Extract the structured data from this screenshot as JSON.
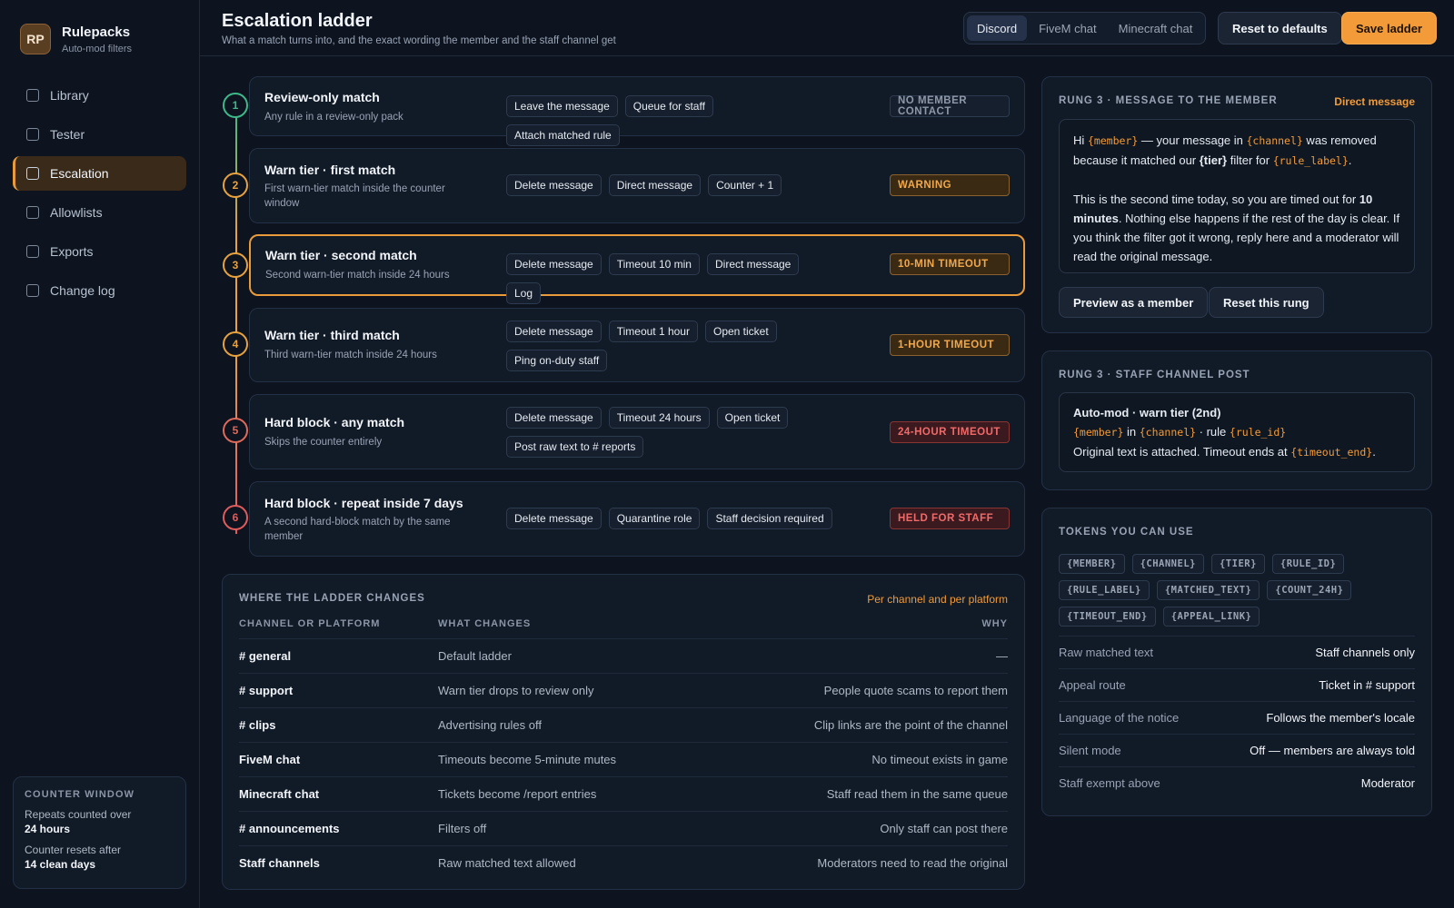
{
  "brand": {
    "initials": "RP",
    "name": "Rulepacks",
    "subtitle": "Auto-mod filters"
  },
  "nav": [
    {
      "label": "Library"
    },
    {
      "label": "Tester"
    },
    {
      "label": "Escalation",
      "active": true
    },
    {
      "label": "Allowlists"
    },
    {
      "label": "Exports"
    },
    {
      "label": "Change log"
    }
  ],
  "counter_window": {
    "title": "COUNTER WINDOW",
    "repeats_label": "Repeats counted over",
    "repeats_value": "24 hours",
    "resets_label": "Counter resets after",
    "resets_value": "14 clean days"
  },
  "header": {
    "title": "Escalation ladder",
    "subtitle": "What a match turns into, and the exact wording the member and the staff channel get",
    "platforms": [
      "Discord",
      "FiveM chat",
      "Minecraft chat"
    ],
    "active_platform": "Discord",
    "reset_label": "Reset to defaults",
    "save_label": "Save ladder"
  },
  "rungs": [
    {
      "num": "1",
      "title": "Review-only match",
      "subtitle": "Any rule in a review-only pack",
      "actions": [
        "Leave the message",
        "Queue for staff",
        "Attach matched rule"
      ],
      "badge": "NO MEMBER CONTACT"
    },
    {
      "num": "2",
      "title": "Warn tier · first match",
      "subtitle": "First warn-tier match inside the counter window",
      "actions": [
        "Delete message",
        "Direct message",
        "Counter + 1"
      ],
      "badge": "WARNING"
    },
    {
      "num": "3",
      "title": "Warn tier · second match",
      "subtitle": "Second warn-tier match inside 24 hours",
      "actions": [
        "Delete message",
        "Timeout 10 min",
        "Direct message",
        "Log"
      ],
      "badge": "10-MIN TIMEOUT"
    },
    {
      "num": "4",
      "title": "Warn tier · third match",
      "subtitle": "Third warn-tier match inside 24 hours",
      "actions": [
        "Delete message",
        "Timeout 1 hour",
        "Open ticket",
        "Ping on-duty staff"
      ],
      "badge": "1-HOUR TIMEOUT"
    },
    {
      "num": "5",
      "title": "Hard block · any match",
      "subtitle": "Skips the counter entirely",
      "actions": [
        "Delete message",
        "Timeout 24 hours",
        "Open ticket",
        "Post raw text to # reports"
      ],
      "badge": "24-HOUR TIMEOUT"
    },
    {
      "num": "6",
      "title": "Hard block · repeat inside 7 days",
      "subtitle": "A second hard-block match by the same member",
      "actions": [
        "Delete message",
        "Quarantine role",
        "Staff decision required"
      ],
      "badge": "HELD FOR STAFF"
    }
  ],
  "ladder_changes": {
    "title": "WHERE THE LADDER CHANGES",
    "note": "Per channel and per platform",
    "headers": [
      "CHANNEL OR PLATFORM",
      "WHAT CHANGES",
      "WHY"
    ],
    "rows": [
      [
        "# general",
        "Default ladder",
        "—"
      ],
      [
        "# support",
        "Warn tier drops to review only",
        "People quote scams to report them"
      ],
      [
        "# clips",
        "Advertising rules off",
        "Clip links are the point of the channel"
      ],
      [
        "FiveM chat",
        "Timeouts become 5-minute mutes",
        "No timeout exists in game"
      ],
      [
        "Minecraft chat",
        "Tickets become /report entries",
        "Staff read them in the same queue"
      ],
      [
        "# announcements",
        "Filters off",
        "Only staff can post there"
      ],
      [
        "Staff channels",
        "Raw matched text allowed",
        "Moderators need to read the original"
      ]
    ]
  },
  "member_message": {
    "title": "RUNG 3 · MESSAGE TO THE MEMBER",
    "channel_link": "Direct message",
    "p1": [
      "Hi ",
      "{member}",
      " — your message in ",
      "{channel}",
      " was removed because it matched our ",
      "{tier}",
      " filter for ",
      "{rule_label}",
      "."
    ],
    "p2": [
      "This is the second time today, so you are timed out for ",
      "10 minutes",
      ". Nothing else happens if the rest of the day is clear. If you think the filter got it wrong, reply here and a moderator will read the original message."
    ],
    "preview_label": "Preview as a member",
    "reset_label": "Reset this rung"
  },
  "staff_post": {
    "title": "RUNG 3 · STAFF CHANNEL POST",
    "line1": "Auto-mod · warn tier (2nd)",
    "line2": [
      "{member}",
      " in ",
      "{channel}",
      " · rule ",
      "{rule_id}"
    ],
    "line3": [
      "Original text is attached. Timeout ends at ",
      "{timeout_end}",
      "."
    ]
  },
  "tokens": {
    "title": "TOKENS YOU CAN USE",
    "items": [
      "{MEMBER}",
      "{CHANNEL}",
      "{TIER}",
      "{RULE_ID}",
      "{RULE_LABEL}",
      "{MATCHED_TEXT}",
      "{COUNT_24H}",
      "{TIMEOUT_END}",
      "{APPEAL_LINK}"
    ],
    "settings": [
      [
        "Raw matched text",
        "Staff channels only"
      ],
      [
        "Appeal route",
        "Ticket in # support"
      ],
      [
        "Language of the notice",
        "Follows the member's locale"
      ],
      [
        "Silent mode",
        "Off — members are always told"
      ],
      [
        "Staff exempt above",
        "Moderator"
      ]
    ]
  },
  "colors": {
    "accent": "#f29b38",
    "green": "#3fb98a",
    "amber": "#e8a23e",
    "red": "#e05c5c",
    "bg": "#0d1420",
    "panel": "#111a27"
  }
}
